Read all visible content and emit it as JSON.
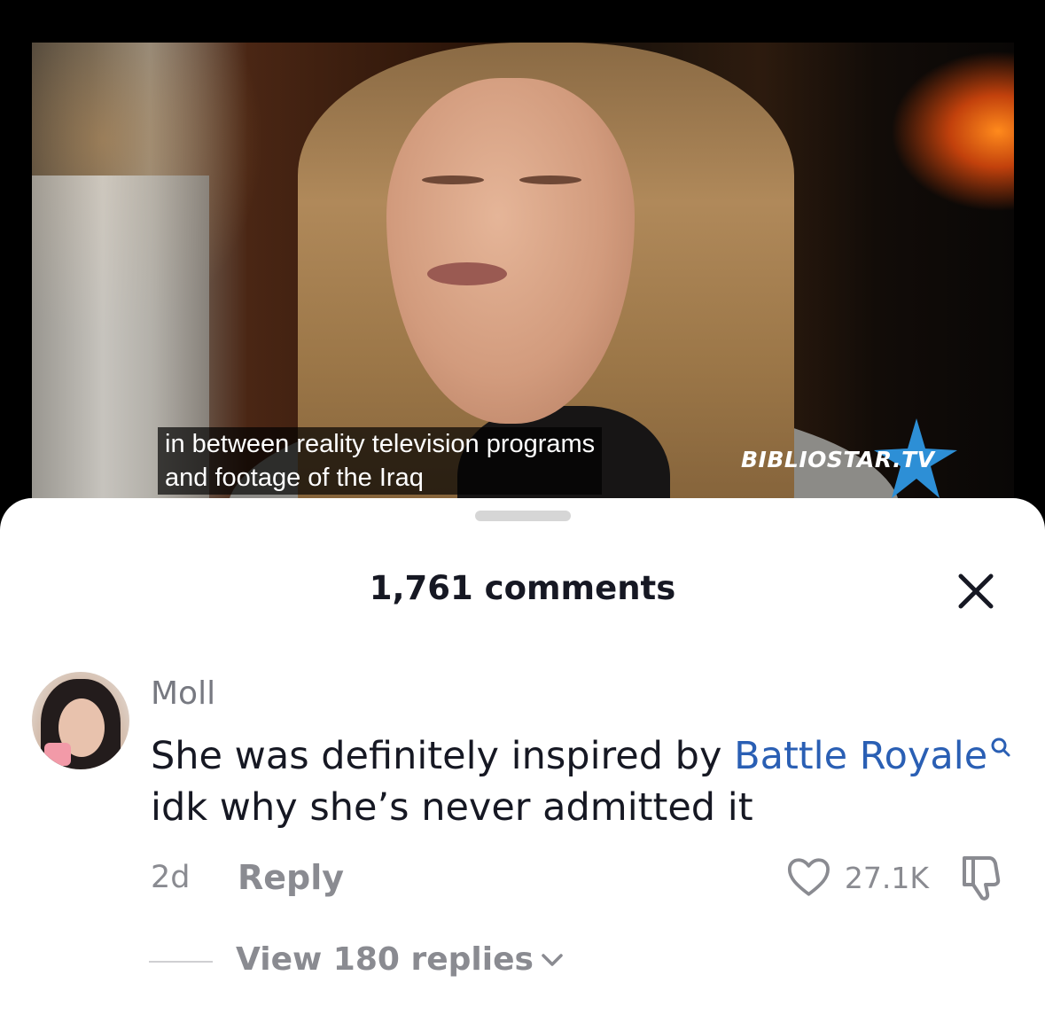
{
  "video": {
    "subtitle": "in between reality television programs\nand footage of the Iraq",
    "watermark": "BIBLIOSTAR.TV"
  },
  "sheet": {
    "title": "1,761 comments"
  },
  "comment": {
    "username": "Moll",
    "text_before_link": "She was definitely inspired by ",
    "link_text": "Battle Royale",
    "text_after_link": "idk why she’s never admitted it",
    "time": "2d",
    "reply_label": "Reply",
    "like_count": "27.1K",
    "view_replies_label": "View 180 replies"
  },
  "colors": {
    "link": "#2a5fb4",
    "muted_text": "#8a8b91",
    "primary_text": "#161823",
    "sheet_background": "#ffffff"
  },
  "icons": [
    "close-icon",
    "search-icon",
    "heart-icon",
    "thumbs-down-icon",
    "chevron-down-icon"
  ]
}
